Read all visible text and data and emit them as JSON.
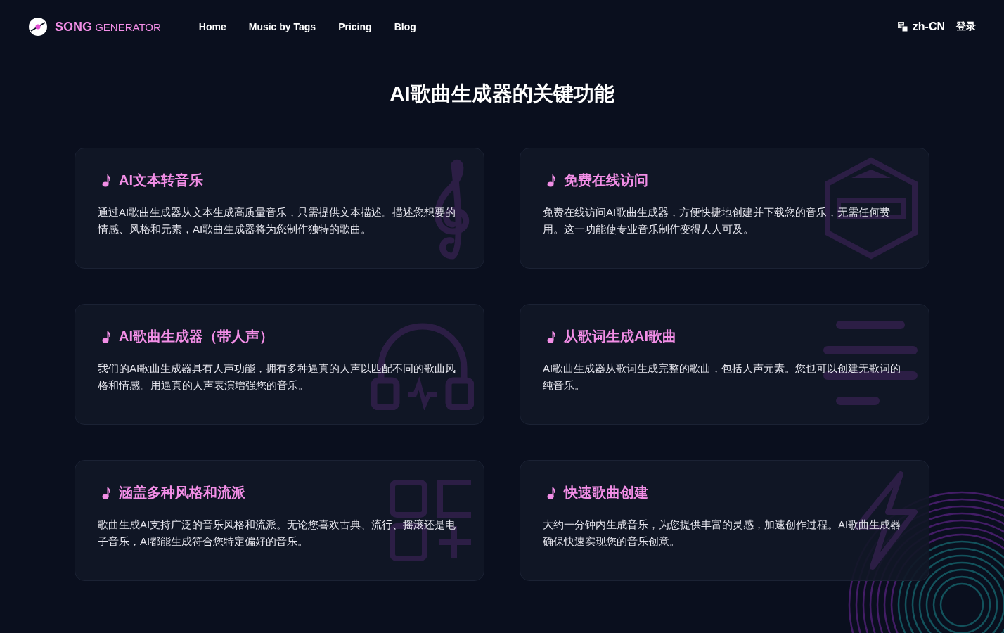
{
  "header": {
    "logo": {
      "primary": "SONG",
      "secondary": "GENERATOR"
    },
    "nav": [
      {
        "label": "Home"
      },
      {
        "label": "Music by Tags"
      },
      {
        "label": "Pricing"
      },
      {
        "label": "Blog"
      }
    ],
    "language": "zh-CN",
    "login": "登录"
  },
  "section_title": "AI歌曲生成器的关键功能",
  "features": [
    {
      "title": "AI文本转音乐",
      "description": "通过AI歌曲生成器从文本生成高质量音乐，只需提供文本描述。描述您想要的情感、风格和元素，AI歌曲生成器将为您制作独特的歌曲。",
      "kind": "clef"
    },
    {
      "title": "免费在线访问",
      "description": "免费在线访问AI歌曲生成器，方便快捷地创建并下载您的音乐，无需任何费用。这一功能使专业音乐制作变得人人可及。",
      "kind": "free"
    },
    {
      "title": "AI歌曲生成器（带人声）",
      "description": "我们的AI歌曲生成器具有人声功能，拥有多种逼真的人声以匹配不同的歌曲风格和情感。用逼真的人声表演增强您的音乐。",
      "kind": "headphones"
    },
    {
      "title": "从歌词生成AI歌曲",
      "description": "AI歌曲生成器从歌词生成完整的歌曲，包括人声元素。您也可以创建无歌词的纯音乐。",
      "kind": "lyrics"
    },
    {
      "title": "涵盖多种风格和流派",
      "description": "歌曲生成AI支持广泛的音乐风格和流派。无论您喜欢古典、流行、摇滚还是电子音乐，AI都能生成符合您特定偏好的音乐。",
      "kind": "genres"
    },
    {
      "title": "快速歌曲创建",
      "description": "大约一分钟内生成音乐，为您提供丰富的灵感，加速创作过程。AI歌曲生成器确保快速实现您的音乐创意。",
      "kind": "bolt"
    }
  ]
}
